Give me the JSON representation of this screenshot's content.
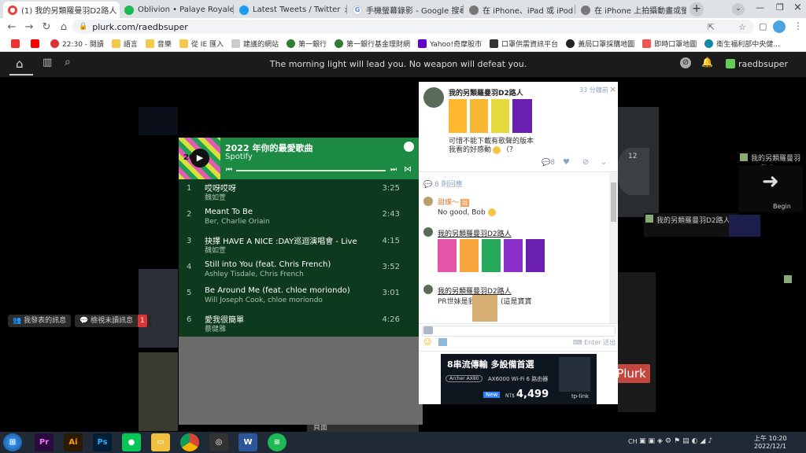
{
  "browser": {
    "tabs": [
      {
        "label": "(1) 我的另類羅曼羽D2路人 ||",
        "active": true
      },
      {
        "label": "Oblivion • Palaye Royale",
        "active": false
      },
      {
        "label": "Latest Tweets / Twitter",
        "active": false
      },
      {
        "label": "手機螢幕錄影 - Google 搜尋",
        "active": false
      },
      {
        "label": "在 iPhone、iPad 或 iPod to",
        "active": false
      },
      {
        "label": "在 iPhone 上拍攝動畫或螢幕",
        "active": false
      }
    ],
    "url": "plurk.com/raedbsuper",
    "bookmarks": [
      "22:30 - 閱讀",
      "語言",
      "音樂",
      "從 IE 匯入",
      "建議的網站",
      "第一銀行",
      "第一銀行基金理財網",
      "Yahoo!奇摩股市",
      "口罩供需資訊平台",
      "黃局口罩採購地圖",
      "即時口罩地圖",
      "衛生福利部中央健..."
    ]
  },
  "plurk": {
    "slogan": "The morning light will lead you. No weapon will defeat you.",
    "username": "raedbsuper",
    "my_messages": "我發表的訊息",
    "unread": "檢視未讀訊息",
    "unread_count": "1",
    "bg_labels": {
      "name_right": "我的另類羅曼羽D2路人",
      "name_mid": "我的另類羅曼羽D2路人",
      "begin": "Begin",
      "plurk_btn": "Plurk",
      "count12": "12"
    }
  },
  "spotify": {
    "cover_text": "2022",
    "title": "2022 年你的最愛歌曲",
    "brand": "Spotify",
    "tracks": [
      {
        "n": "1",
        "title": "哎呀哎呀",
        "artist": "魏如萱",
        "duration": "3:25"
      },
      {
        "n": "2",
        "title": "Meant To Be",
        "artist": "Ber, Charlie Oriain",
        "duration": "2:43"
      },
      {
        "n": "3",
        "title": "抉擇 HAVE A NICE :DAY巡迴演唱會 - Live",
        "artist": "魏如萱",
        "duration": "4:15"
      },
      {
        "n": "4",
        "title": "Still into You (feat. Chris French)",
        "artist": "Ashley Tisdale, Chris French",
        "duration": "3:52"
      },
      {
        "n": "5",
        "title": "Be Around Me (feat. chloe moriondo)",
        "artist": "Will Joseph Cook, chloe moriondo",
        "duration": "3:01"
      },
      {
        "n": "6",
        "title": "愛我很簡單",
        "artist": "蔡健雅",
        "duration": "4:26"
      }
    ]
  },
  "popup": {
    "author": "我的另類羅曼羽D2路人",
    "time": "33 分鐘前",
    "text_line1": "可惜不能下載有歌聲的版本",
    "text_line2": "我看的好感動",
    "text_tail": "（？",
    "response_count": "8",
    "responses_label": "8 則回應",
    "replies": [
      {
        "author": "甜蝶～",
        "text": "No good, Bob"
      },
      {
        "author": "我的另類羅曼羽D2路人",
        "text": ""
      },
      {
        "author": "我的另類羅曼羽D2路人",
        "text": "PR世妹是我",
        "tail": "(這是寶寶"
      }
    ],
    "input_hint": "Enter 送出",
    "ad_line1": "8串流傳輸  多設備首選",
    "ad_product": "Archer AX80",
    "ad_spec": "AX6000 Wi-Fi 6 路由器",
    "ad_new": "New",
    "ad_price_prefix": "NT$",
    "ad_price": "4,499",
    "ad_brand": "tp-link"
  },
  "taskbar": {
    "time": "上午 10:20",
    "date": "2022/12/1",
    "lang": "CH"
  }
}
